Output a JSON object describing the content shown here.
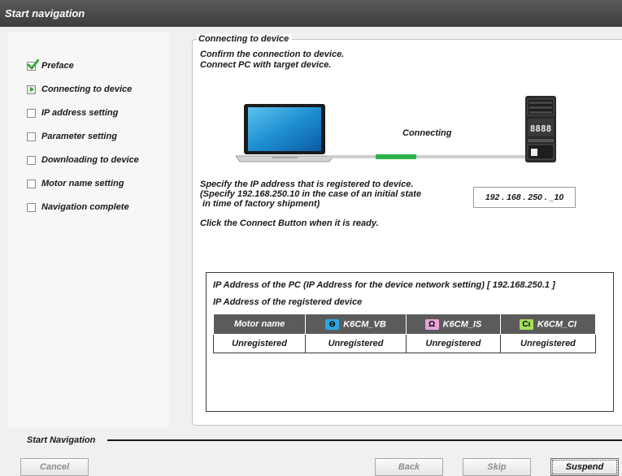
{
  "window": {
    "title": "Start navigation"
  },
  "sidebar": {
    "items": [
      {
        "label": "Preface",
        "state": "checked"
      },
      {
        "label": "Connecting to device",
        "state": "current"
      },
      {
        "label": "IP address setting",
        "state": "unchecked"
      },
      {
        "label": "Parameter setting",
        "state": "unchecked"
      },
      {
        "label": "Downloading to device",
        "state": "unchecked"
      },
      {
        "label": "Motor name setting",
        "state": "unchecked"
      },
      {
        "label": "Navigation complete",
        "state": "unchecked"
      }
    ]
  },
  "main": {
    "section_title": "Connecting to device",
    "intro_line1": "Confirm the connection to device.",
    "intro_line2": "Connect PC with target device.",
    "connecting_label": "Connecting",
    "ip_instruction1": "Specify the IP address that is registered to device.",
    "ip_instruction2": "(Specify 192.168.250.10 in the case of an initial state",
    "ip_instruction3": " in time of factory shipment)",
    "connect_hint": "Click the Connect Button when it is ready.",
    "ip_value": "192 . 168 . 250 . _10",
    "device_display": "8888"
  },
  "info": {
    "pc_ip_line": "IP Address of the PC (IP Address for the device network setting)  [ 192.168.250.1 ]",
    "registered_label": "IP Address of the registered device",
    "table": {
      "headers": [
        {
          "label": "Motor name",
          "icon": ""
        },
        {
          "label": "K6CM_VB",
          "icon": "vibration-icon",
          "icon_glyph": "⊖",
          "icon_color": "#2aa7e0"
        },
        {
          "label": "K6CM_IS",
          "icon": "insulation-icon",
          "icon_glyph": "Ω",
          "icon_color": "#e9a3d8"
        },
        {
          "label": "K6CM_CI",
          "icon": "current-icon",
          "icon_glyph": "Cı",
          "icon_color": "#a6df5a"
        }
      ],
      "rows": [
        [
          "Unregistered",
          "Unregistered",
          "Unregistered",
          "Unregistered"
        ]
      ]
    }
  },
  "footer": {
    "step_label": "Start Navigation",
    "buttons": {
      "cancel": "Cancel",
      "back": "Back",
      "skip": "Skip",
      "suspend": "Suspend"
    }
  },
  "colors": {
    "titlebar": "#474747",
    "progress": "#2db24a",
    "check": "#36a83a"
  }
}
